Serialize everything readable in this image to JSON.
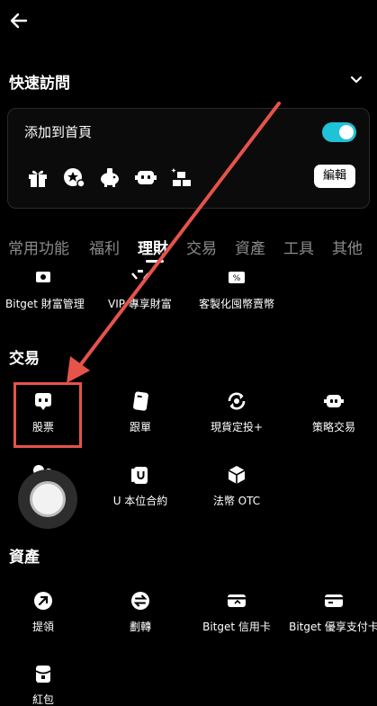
{
  "header": {
    "back_icon": "arrow-left-icon"
  },
  "quick_access": {
    "title": "快速訪問",
    "collapse_icon": "chevron-down-icon",
    "add_to_home_label": "添加到首頁",
    "toggle_on": true,
    "toggle_color": "#1fc2d6",
    "icons": [
      "gift-icon",
      "star-user-icon",
      "piggy-bank-icon",
      "robot-icon",
      "gold-bars-icon"
    ],
    "edit_label": "編輯"
  },
  "tabs": [
    "常用功能",
    "福利",
    "理財",
    "交易",
    "資產",
    "工具",
    "其他"
  ],
  "active_tab": "理財",
  "finance_items": [
    "Bitget 財富管理",
    "VIP 專享財富",
    "客製化囤幣賣幣"
  ],
  "trading": {
    "title": "交易",
    "items": [
      "股票",
      "跟單",
      "現貨定投+",
      "策略交易",
      "U 本位合約",
      "法幣 OTC"
    ]
  },
  "assets": {
    "title": "資產",
    "items": [
      "提領",
      "劃轉",
      "Bitget 信用卡",
      "Bitget 優享支付卡",
      "紅包"
    ]
  },
  "annotation_color": "#e5534b"
}
